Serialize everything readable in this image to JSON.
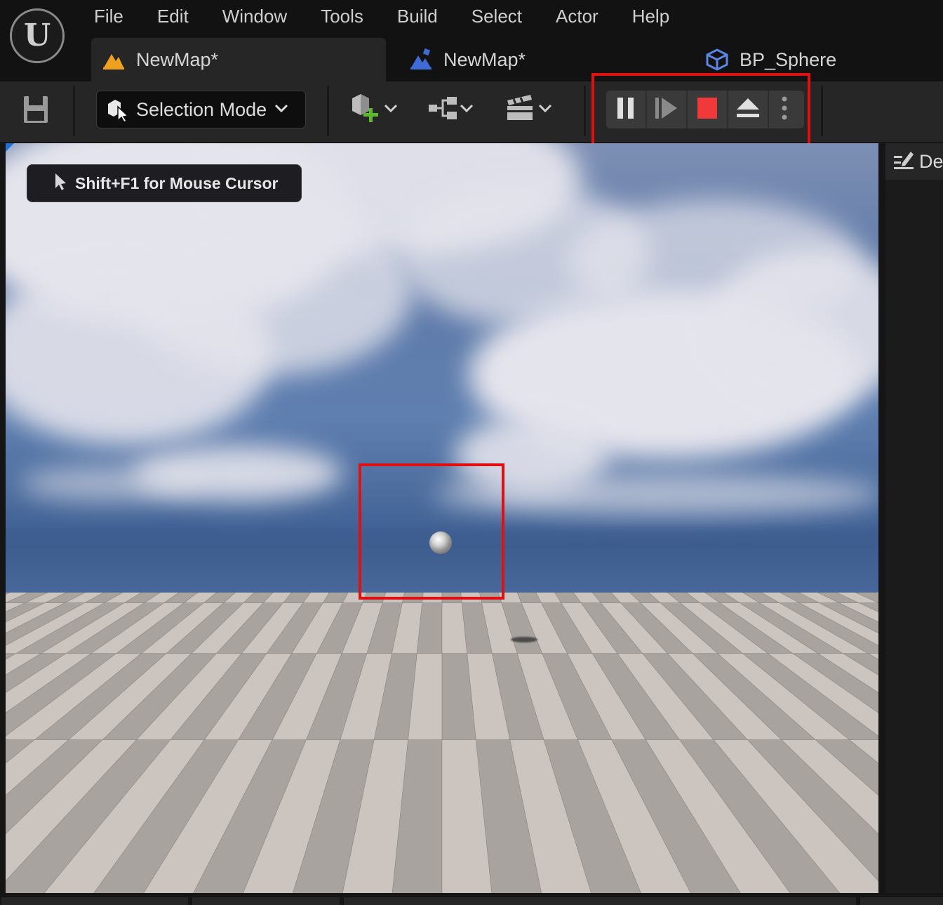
{
  "app": {
    "logo_icon": "unreal-engine-logo-icon",
    "logo_glyph": "U"
  },
  "menu": [
    "File",
    "Edit",
    "Window",
    "Tools",
    "Build",
    "Select",
    "Actor",
    "Help"
  ],
  "tabs": [
    {
      "label": "NewMap*",
      "icon": "level-map-icon",
      "active": true
    },
    {
      "label": "NewMap*",
      "icon": "level-map-blue-icon",
      "active": false
    },
    {
      "label": "BP_Sphere",
      "icon": "blueprint-icon",
      "active": false
    }
  ],
  "toolbar": {
    "save_icon": "save-icon",
    "selection_mode_label": "Selection Mode",
    "add_actor_icon": "add-actor-icon",
    "blueprints_icon": "blueprint-graph-icon",
    "cinematics_icon": "clapperboard-icon",
    "play_controls": [
      "pause-icon",
      "frame-advance-icon",
      "stop-icon",
      "eject-icon",
      "more-options-icon"
    ],
    "accent_stop": "#f03a3a"
  },
  "viewport": {
    "cursor_hint": "Shift+F1 for Mouse Cursor"
  },
  "right_panel": {
    "details_label": "De",
    "details_icon": "details-edit-icon"
  },
  "annotations": {
    "highlight_color": "#e01010"
  }
}
